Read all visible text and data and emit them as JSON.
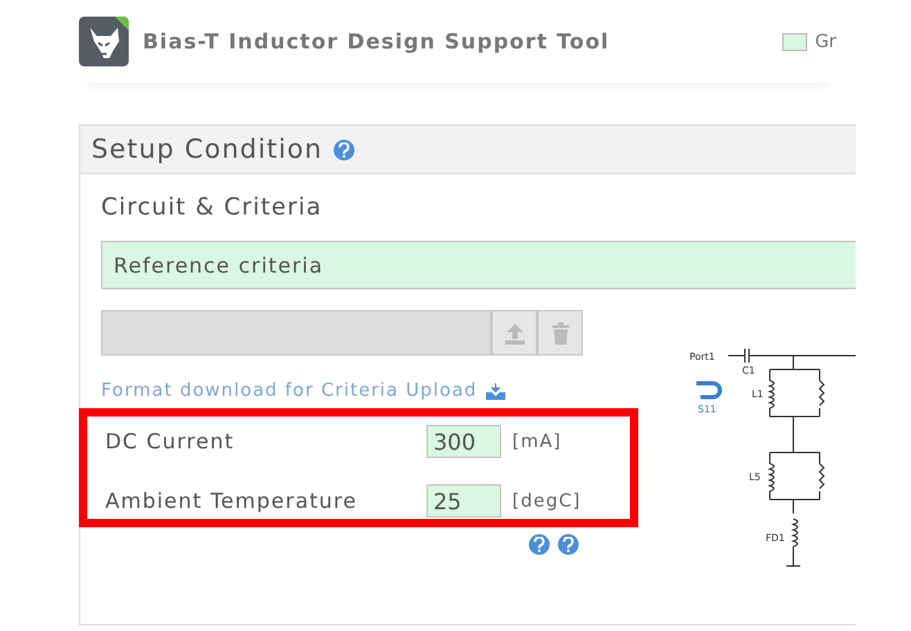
{
  "header": {
    "title": "Bias-T Inductor Design Support Tool",
    "legend": {
      "label": "Gr",
      "color": "#d9f7e1"
    }
  },
  "panel": {
    "title": "Setup Condition",
    "section": "Circuit & Criteria",
    "criteria_bar": "Reference criteria",
    "format_link": "Format download for Criteria Upload",
    "fields": [
      {
        "label": "DC Current",
        "value": "300",
        "unit": "[mA]"
      },
      {
        "label": "Ambient Temperature",
        "value": "25",
        "unit": "[degC]"
      }
    ],
    "circuit": {
      "labels": [
        "Port1",
        "C1",
        "L1",
        "L5",
        "FD1"
      ],
      "s_param": "S11"
    }
  },
  "highlight": {
    "color": "#ff0000"
  }
}
